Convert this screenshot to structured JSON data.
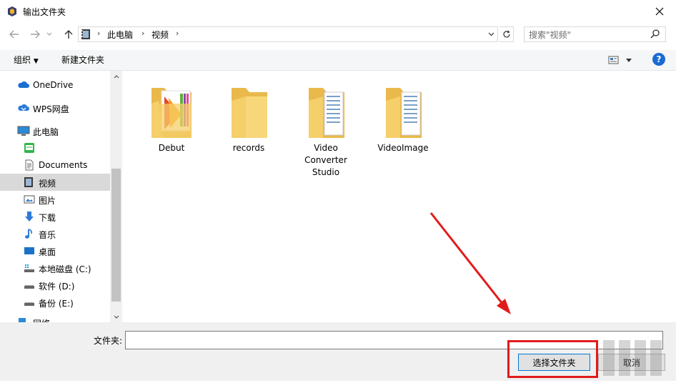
{
  "window": {
    "title": "输出文件夹"
  },
  "address": {
    "crumbs": [
      "此电脑",
      "视频"
    ]
  },
  "search": {
    "placeholder": "搜索\"视频\""
  },
  "toolbar": {
    "organize": "组织",
    "new_folder": "新建文件夹"
  },
  "sidebar": {
    "items": [
      {
        "label": "OneDrive",
        "icon": "cloud-icon"
      },
      {
        "label": "WPS网盘",
        "icon": "wps-cloud-icon"
      },
      {
        "label": "此电脑",
        "icon": "computer-icon"
      },
      {
        "label": "",
        "icon": "app-folder-icon"
      },
      {
        "label": "Documents",
        "icon": "document-icon"
      },
      {
        "label": "视频",
        "icon": "video-icon"
      },
      {
        "label": "图片",
        "icon": "pictures-icon"
      },
      {
        "label": "下载",
        "icon": "download-icon"
      },
      {
        "label": "音乐",
        "icon": "music-icon"
      },
      {
        "label": "桌面",
        "icon": "desktop-icon"
      },
      {
        "label": "本地磁盘 (C:)",
        "icon": "drive-c-icon"
      },
      {
        "label": "软件 (D:)",
        "icon": "drive-icon"
      },
      {
        "label": "备份 (E:)",
        "icon": "drive-icon"
      },
      {
        "label": "网络",
        "icon": "network-icon"
      }
    ],
    "selected": "视频"
  },
  "folders": [
    {
      "name": "Debut",
      "icon": "folder-colorful-icon"
    },
    {
      "name": "records",
      "icon": "folder-icon"
    },
    {
      "name": "Video Converter Studio",
      "line1": "Video",
      "line2": "Converter",
      "line3": "Studio",
      "icon": "folder-docs-icon"
    },
    {
      "name": "VideoImage",
      "icon": "folder-docs-icon"
    }
  ],
  "bottom": {
    "folder_label": "文件夹:",
    "folder_value": "",
    "select_button": "选择文件夹",
    "cancel_button": "取消"
  },
  "colors": {
    "accent": "#0078d7",
    "highlight": "#e11b1b",
    "folder": "#f5cf6a",
    "selected": "#d9d9d9"
  }
}
